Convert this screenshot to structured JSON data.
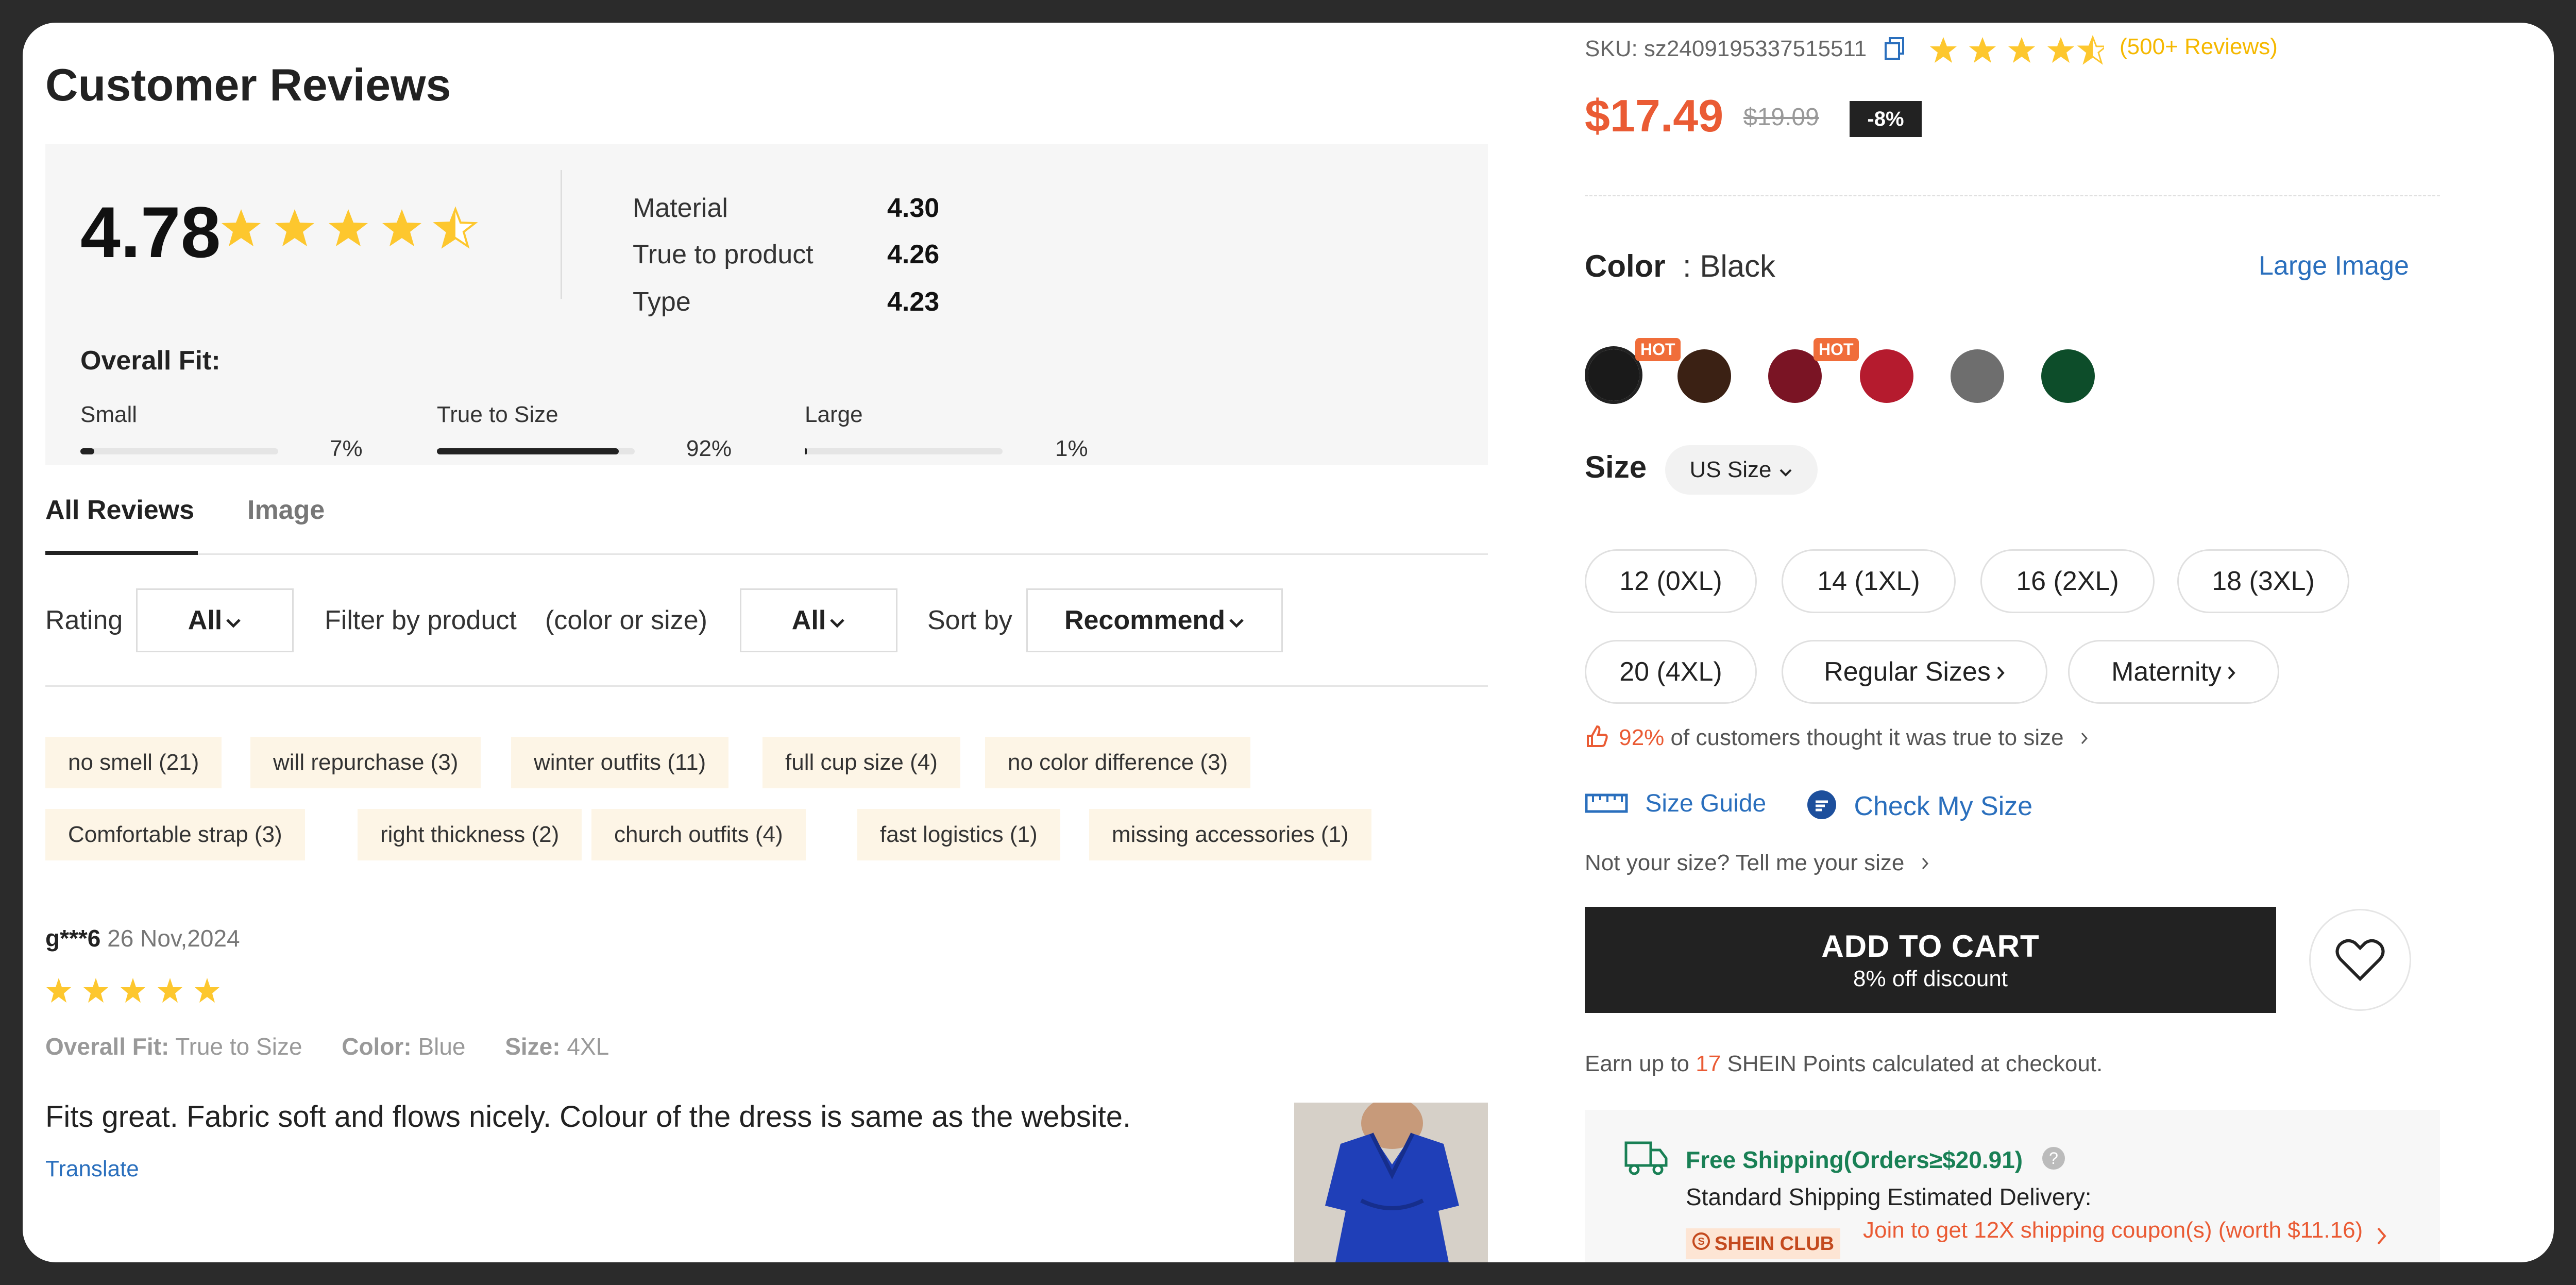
{
  "reviews": {
    "title": "Customer Reviews",
    "overall_score": "4.78",
    "overall_stars": 4.5,
    "metrics": [
      {
        "label": "Material",
        "value": "4.30"
      },
      {
        "label": "True to product",
        "value": "4.26"
      },
      {
        "label": "Type",
        "value": "4.23"
      }
    ],
    "overall_fit": {
      "title": "Overall Fit:",
      "items": [
        {
          "label": "Small",
          "percent": "7%",
          "value": 0.07
        },
        {
          "label": "True to Size",
          "percent": "92%",
          "value": 0.92
        },
        {
          "label": "Large",
          "percent": "1%",
          "value": 0.01
        }
      ]
    },
    "tabs": [
      {
        "label": "All Reviews",
        "active": true
      },
      {
        "label": "Image",
        "active": false
      }
    ],
    "filters": {
      "rating_label": "Rating",
      "rating_value": "All",
      "product_label": "Filter by product",
      "product_hint": "(color or size)",
      "product_value": "All",
      "sort_label": "Sort by",
      "sort_value": "Recommend"
    },
    "tags_row1": [
      "no smell (21)",
      "will repurchase (3)",
      "winter outfits (11)",
      "full cup size (4)",
      "no color difference (3)"
    ],
    "tags_row2": [
      "Comfortable strap (3)",
      "right thickness (2)",
      "church outfits (4)",
      "fast logistics (1)",
      "missing accessories (1)"
    ],
    "review": {
      "user": "g***6",
      "date": "26 Nov,2024",
      "stars": 5,
      "fit_label": "Overall Fit:",
      "fit_value": "True to Size",
      "color_label": "Color:",
      "color_value": "Blue",
      "size_label": "Size:",
      "size_value": "4XL",
      "text": "Fits great. Fabric soft and flows nicely. Colour of the dress is same as the website.",
      "translate": "Translate"
    }
  },
  "product": {
    "sku": "SKU: sz2409195337515511",
    "rating_stars": 4.5,
    "reviews_count": "(500+ Reviews)",
    "price": "$17.49",
    "old_price": "$19.09",
    "discount": "-8%",
    "color_label": "Color",
    "color_value": ": Black",
    "large_image": "Large Image",
    "swatches": [
      {
        "name": "black",
        "color": "#1a1a1a",
        "hot": true,
        "selected": true
      },
      {
        "name": "brown",
        "color": "#3b2114",
        "hot": false,
        "selected": false
      },
      {
        "name": "burgundy",
        "color": "#7a1424",
        "hot": true,
        "selected": false
      },
      {
        "name": "red",
        "color": "#b51b2e",
        "hot": false,
        "selected": false
      },
      {
        "name": "grey",
        "color": "#6e6e6e",
        "hot": false,
        "selected": false
      },
      {
        "name": "green",
        "color": "#0d4d2a",
        "hot": false,
        "selected": false
      }
    ],
    "hot_label": "HOT",
    "size_label": "Size",
    "size_system": "US Size",
    "sizes_row1": [
      "12 (0XL)",
      "14 (1XL)",
      "16 (2XL)",
      "18 (3XL)"
    ],
    "sizes_row2": [
      "20 (4XL)",
      "Regular Sizes",
      "Maternity"
    ],
    "tts_percent": "92%",
    "tts_text": "of customers thought it was true to size",
    "size_guide": "Size Guide",
    "check_size": "Check My Size",
    "not_size": "Not your size? Tell me your size",
    "add_to_cart": "ADD TO CART",
    "add_to_cart_sub": "8% off discount",
    "points_pre": "Earn up to",
    "points_num": "17",
    "points_post": "SHEIN Points calculated at checkout.",
    "shipping_title": "Free Shipping(Orders≥$20.91)",
    "shipping_est": "Standard Shipping Estimated Delivery:",
    "club_label": "SHEIN CLUB",
    "club_text": "Join to get 12X shipping coupon(s) (worth $11.16)",
    "accent": "#ea5b34",
    "link_color": "#2a6fbd",
    "star_color": "#fdc72e"
  }
}
